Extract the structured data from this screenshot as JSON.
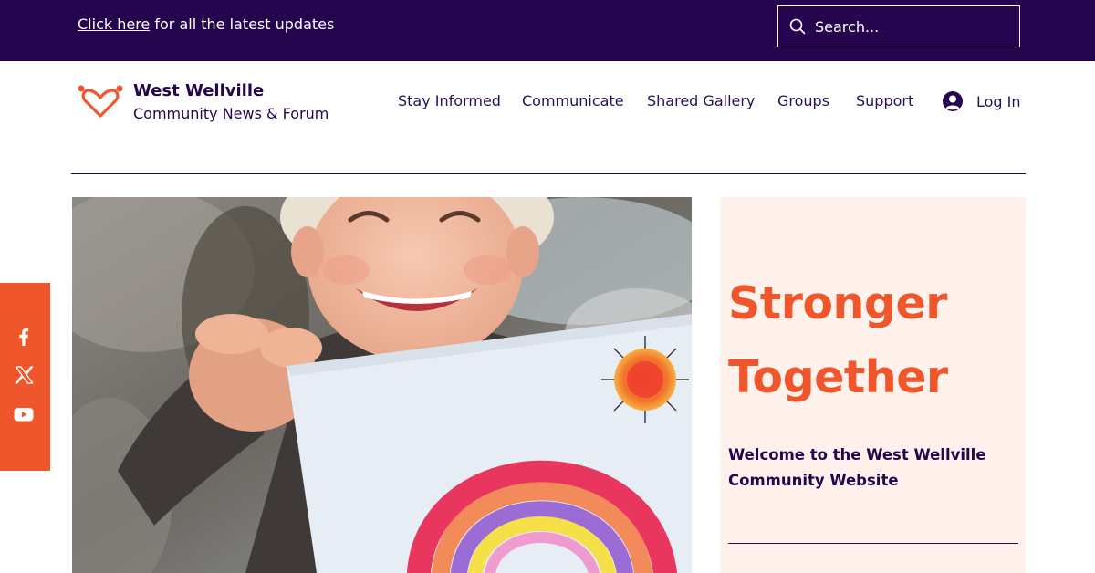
{
  "banner": {
    "link_text": "Click here",
    "text": " for all the latest updates",
    "search_placeholder": "Search..."
  },
  "brand": {
    "title": "West Wellville",
    "subtitle": "Community News & Forum"
  },
  "nav": {
    "items": [
      {
        "label": "Stay Informed"
      },
      {
        "label": "Communicate"
      },
      {
        "label": "Shared Gallery"
      },
      {
        "label": "Groups"
      },
      {
        "label": "Support"
      }
    ],
    "login_label": "Log In"
  },
  "hero": {
    "heading_line1": "Stronger",
    "heading_line2": "Together",
    "subheading": "Welcome to the West Wellville Community Website"
  },
  "social": {
    "icons": [
      "facebook-icon",
      "x-icon",
      "youtube-icon"
    ]
  },
  "colors": {
    "banner_bg": "#26054f",
    "accent": "#f0562c",
    "panel_bg": "#fff1ec",
    "text_dark": "#2b0f57"
  }
}
